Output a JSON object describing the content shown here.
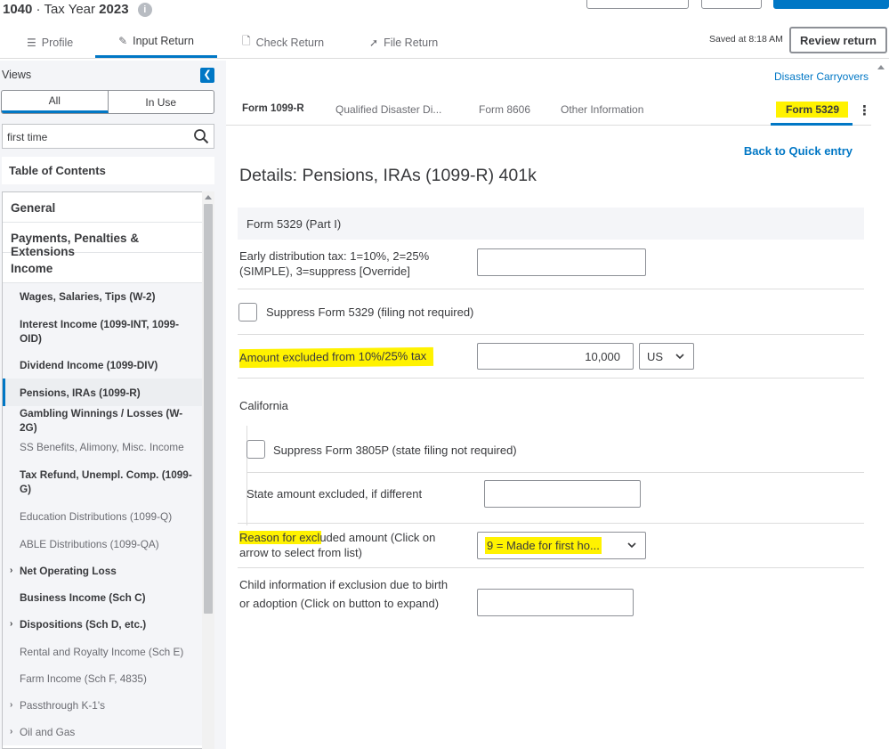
{
  "header": {
    "form_number": "1040",
    "separator": "·",
    "tax_year_label": "Tax Year",
    "tax_year": "2023",
    "info_icon": "info-icon"
  },
  "tabs": [
    {
      "label": "Profile",
      "icon": "list-icon"
    },
    {
      "label": "Input Return",
      "icon": "edit-icon"
    },
    {
      "label": "Check Return",
      "icon": "document-icon"
    },
    {
      "label": "File Return",
      "icon": "send-icon"
    }
  ],
  "saved_text": "Saved at 8:18 AM",
  "review_button": "Review return",
  "sidebar": {
    "views_label": "Views",
    "view_tabs": [
      "All",
      "In Use"
    ],
    "search_value": "first time",
    "toc_label": "Table of Contents",
    "categories": [
      "General",
      "Payments, Penalties & Extensions",
      "Income"
    ],
    "items": [
      {
        "label": "Wages, Salaries, Tips (W-2)",
        "style": "bold"
      },
      {
        "label": "Interest Income (1099-INT, 1099-OID)",
        "style": "bold"
      },
      {
        "label": "Dividend Income (1099-DIV)",
        "style": "bold"
      },
      {
        "label": "Pensions, IRAs (1099-R)",
        "style": "selected"
      },
      {
        "label": "Gambling Winnings / Losses (W-2G)",
        "style": "bold"
      },
      {
        "label": "SS Benefits, Alimony, Misc. Income",
        "style": "muted"
      },
      {
        "label": "Tax Refund, Unempl. Comp. (1099-G)",
        "style": "bold"
      },
      {
        "label": "Education Distributions (1099-Q)",
        "style": "muted"
      },
      {
        "label": "ABLE Distributions (1099-QA)",
        "style": "muted"
      },
      {
        "label": "Net Operating Loss",
        "style": "bold",
        "caret": true
      },
      {
        "label": "Business Income (Sch C)",
        "style": "bold"
      },
      {
        "label": "Dispositions (Sch D, etc.)",
        "style": "bold",
        "caret": true
      },
      {
        "label": "Rental and Royalty Income (Sch E)",
        "style": "muted"
      },
      {
        "label": "Farm Income (Sch F, 4835)",
        "style": "muted"
      },
      {
        "label": "Passthrough K-1's",
        "style": "muted",
        "caret": true
      },
      {
        "label": "Oil and Gas",
        "style": "muted",
        "caret": true
      }
    ]
  },
  "main": {
    "disaster_link": "Disaster Carryovers",
    "form_tabs": [
      "Form 1099-R",
      "Qualified Disaster Di...",
      "Form 8606",
      "Other Information",
      "Form 5329"
    ],
    "back_link": "Back to Quick entry",
    "page_title": "Details: Pensions, IRAs (1099-R) 401k",
    "section_title": "Form 5329 (Part I)",
    "fields": {
      "early_dist_label": "Early distribution tax: 1=10%, 2=25% (SIMPLE), 3=suppress [Override]",
      "early_dist_value": "",
      "suppress_5329_label": "Suppress Form 5329 (filing not required)",
      "amount_excluded_label": "Amount excluded from 10%/25% tax",
      "amount_excluded_value": "10,000",
      "amount_excluded_unit": "US",
      "california_label": "California",
      "suppress_3805p_label": "Suppress Form 3805P (state filing not required)",
      "state_amount_label": "State amount excluded, if different",
      "state_amount_value": "",
      "reason_label": "Reason for excluded amount (Click on arrow to select from list)",
      "reason_value": "9 = Made for first ho...",
      "child_info_label": "Child information if exclusion due to birth or adoption (Click on button to expand)",
      "child_info_value": ""
    }
  },
  "colors": {
    "accent": "#0077c5",
    "highlight": "#fff200",
    "text": "#393a3d"
  }
}
